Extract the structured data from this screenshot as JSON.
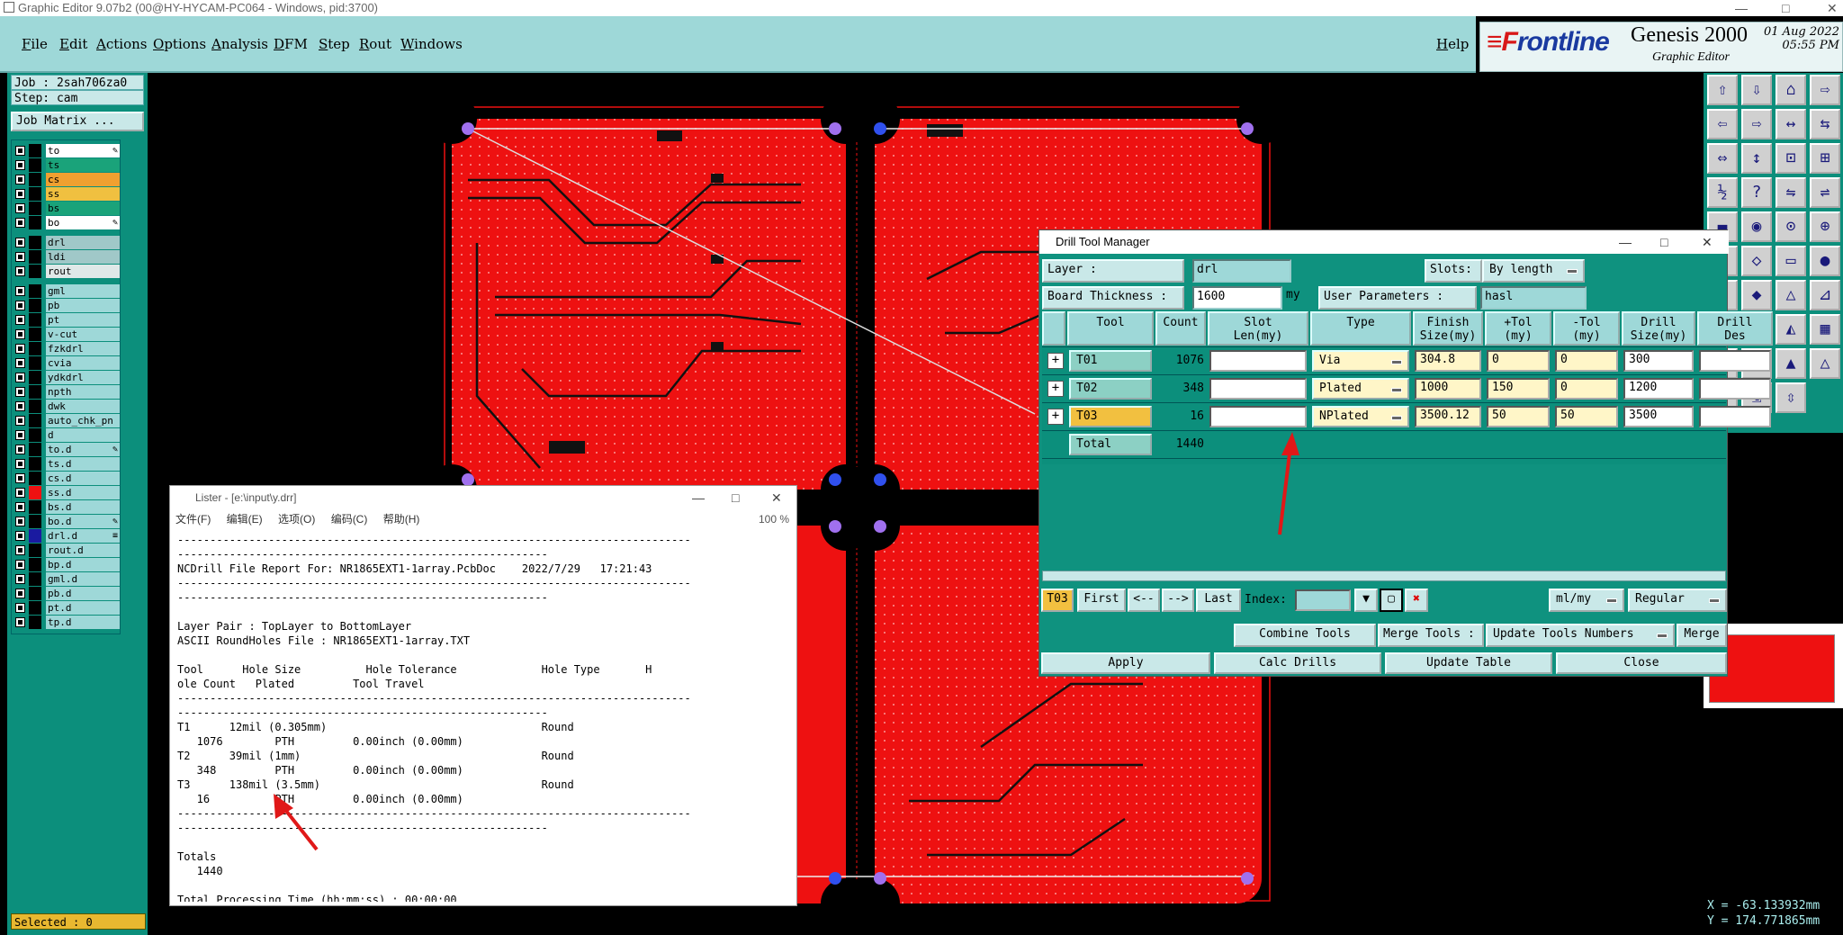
{
  "window": {
    "title": "Graphic Editor 9.07b2 (00@HY-HYCAM-PC064 - Windows, pid:3700)"
  },
  "menubar": {
    "items": [
      "File",
      "Edit",
      "Actions",
      "Options",
      "Analysis",
      "DFM",
      "Step",
      "Rout",
      "Windows"
    ],
    "help": "Help"
  },
  "brand": {
    "logo_a": "≡F",
    "logo_b": "rontline",
    "product": "Genesis 2000",
    "editor": "Graphic Editor",
    "date": "01 Aug 2022",
    "time": "05:55 PM"
  },
  "left": {
    "job": "Job : 2sah706za0",
    "step": "Step: cam",
    "job_matrix": "Job Matrix ...",
    "selected": "Selected : 0",
    "layers": [
      {
        "name": "to",
        "bg": "#ffffff",
        "flag": "✎"
      },
      {
        "name": "ts",
        "bg": "#1aa37a"
      },
      {
        "name": "cs",
        "bg": "#f0a030"
      },
      {
        "name": "ss",
        "bg": "#f0c040"
      },
      {
        "name": "bs",
        "bg": "#1aa37a"
      },
      {
        "name": "bo",
        "bg": "#ffffff",
        "flag": "✎"
      },
      {
        "name": "drl",
        "bg": "#a0c8c8"
      },
      {
        "name": "ldi",
        "bg": "#a0c8c8"
      },
      {
        "name": "rout",
        "bg": "#dfe8e8"
      },
      {
        "name": "gml",
        "bg": "#9ed8d8"
      },
      {
        "name": "pb",
        "bg": "#9ed8d8"
      },
      {
        "name": "pt",
        "bg": "#9ed8d8"
      },
      {
        "name": "v-cut",
        "bg": "#9ed8d8"
      },
      {
        "name": "fzkdrl",
        "bg": "#9ed8d8"
      },
      {
        "name": "cvia",
        "bg": "#9ed8d8"
      },
      {
        "name": "ydkdrl",
        "bg": "#9ed8d8"
      },
      {
        "name": "npth",
        "bg": "#9ed8d8"
      },
      {
        "name": "dwk",
        "bg": "#9ed8d8"
      },
      {
        "name": "auto_chk_pn",
        "bg": "#9ed8d8"
      },
      {
        "name": "d",
        "bg": "#9ed8d8"
      },
      {
        "name": "to.d",
        "bg": "#9ed8d8",
        "flag": "✎"
      },
      {
        "name": "ts.d",
        "bg": "#9ed8d8"
      },
      {
        "name": "cs.d",
        "bg": "#9ed8d8"
      },
      {
        "name": "ss.d",
        "bg": "#9ed8d8",
        "sw": "#ee1111"
      },
      {
        "name": "bs.d",
        "bg": "#9ed8d8"
      },
      {
        "name": "bo.d",
        "bg": "#9ed8d8",
        "flag": "✎"
      },
      {
        "name": "drl.d",
        "bg": "#9ed8d8",
        "sw": "#1a1aa0",
        "flag": "≡"
      },
      {
        "name": "rout.d",
        "bg": "#9ed8d8"
      },
      {
        "name": "bp.d",
        "bg": "#9ed8d8"
      },
      {
        "name": "gml.d",
        "bg": "#9ed8d8"
      },
      {
        "name": "pb.d",
        "bg": "#9ed8d8"
      },
      {
        "name": "pt.d",
        "bg": "#9ed8d8"
      },
      {
        "name": "tp.d",
        "bg": "#9ed8d8"
      }
    ]
  },
  "coords": {
    "x": "X = -63.133932mm",
    "y": "Y = 174.771865mm"
  },
  "dialog": {
    "title": "Drill Tool Manager",
    "layer_label": "Layer          :",
    "layer_value": "drl",
    "slots_label": "Slots:",
    "slots_value": "By length",
    "thickness_label": "Board Thickness :",
    "thickness_value": "1600",
    "thickness_unit": "my",
    "user_params_label": "User Parameters :",
    "user_params_value": "hasl",
    "headers": [
      "Tool",
      "Count",
      "Slot\nLen(my)",
      "Type",
      "Finish\nSize(my)",
      "+Tol\n(my)",
      "-Tol\n(my)",
      "Drill\nSize(my)",
      "Drill\nDes"
    ],
    "rows": [
      {
        "tool": "T01",
        "count": "1076",
        "type": "Via",
        "finish": "304.8",
        "ptol": "0",
        "mtol": "0",
        "drill": "300"
      },
      {
        "tool": "T02",
        "count": "348",
        "type": "Plated",
        "finish": "1000",
        "ptol": "150",
        "mtol": "0",
        "drill": "1200"
      },
      {
        "tool": "T03",
        "count": "16",
        "type": "NPlated",
        "finish": "3500.12",
        "ptol": "50",
        "mtol": "50",
        "drill": "3500"
      }
    ],
    "total_label": "Total",
    "total_count": "1440",
    "nav": {
      "current": "T03",
      "first": "First",
      "prev": "<--",
      "next": "-->",
      "last": "Last",
      "index_label": "Index:",
      "units": "ml/my",
      "mode": "Regular"
    },
    "actions": {
      "combine": "Combine Tools",
      "merge_label": "Merge Tools :",
      "merge_value": "Update Tools Numbers",
      "merge": "Merge"
    },
    "bottom": {
      "apply": "Apply",
      "calc": "Calc Drills",
      "update": "Update Table",
      "close": "Close"
    }
  },
  "lister": {
    "title": "Lister - [e:\\input\\y.drr]",
    "menu": [
      "文件(F)",
      "编辑(E)",
      "选项(O)",
      "编码(C)",
      "帮助(H)"
    ],
    "zoom": "100 %",
    "lines": [
      "-------------------------------------------------------------------------------",
      "---------------------------------------------------------",
      "NCDrill File Report For: NR1865EXT1-1array.PcbDoc    2022/7/29   17:21:43",
      "-------------------------------------------------------------------------------",
      "---------------------------------------------------------",
      "",
      "Layer Pair : TopLayer to BottomLayer",
      "ASCII RoundHoles File : NR1865EXT1-1array.TXT",
      "",
      "Tool      Hole Size          Hole Tolerance             Hole Type       H",
      "ole Count   Plated         Tool Travel",
      "-------------------------------------------------------------------------------",
      "---------------------------------------------------------",
      "T1      12mil (0.305mm)                                 Round",
      "   1076        PTH         0.00inch (0.00mm)",
      "T2      39mil (1mm)                                     Round",
      "   348         PTH         0.00inch (0.00mm)",
      "T3      138mil (3.5mm)                                  Round",
      "   16          PTH         0.00inch (0.00mm)",
      "-------------------------------------------------------------------------------",
      "---------------------------------------------------------",
      "",
      "Totals",
      "   1440",
      "",
      "Total Processing Time (hh:mm:ss) : 00:00:00"
    ]
  }
}
